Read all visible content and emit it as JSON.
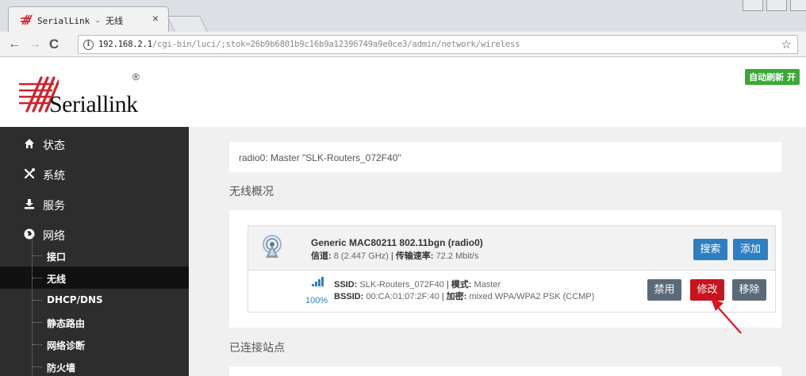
{
  "browser": {
    "tab_title": "SerialLink - 无线",
    "tab_close": "×",
    "url_host": "192.168.2.1",
    "url_path": "/cgi-bin/luci/;stok=26b9b6801b9c16b9a12396749a9e0ce3/admin/network/wireless",
    "info_glyph": "i",
    "back_glyph": "←",
    "forward_glyph": "→",
    "reload_glyph": "C",
    "star_glyph": "☆",
    "icons": [
      "serialink-favicon",
      "back-arrow-icon",
      "forward-arrow-icon",
      "reload-icon",
      "info-icon",
      "star-icon"
    ]
  },
  "header": {
    "logo_text": "Seriallink",
    "logo_reg": "®",
    "autorefresh_label": "自动刷新 开",
    "logo_color": "#d0212a",
    "autorefresh_color": "#3aa935"
  },
  "sidebar": {
    "items": [
      {
        "label": "状态",
        "icon": "home-icon"
      },
      {
        "label": "系统",
        "icon": "tools-icon"
      },
      {
        "label": "服务",
        "icon": "download-tray-icon"
      },
      {
        "label": "网络",
        "icon": "globe-icon"
      }
    ],
    "sub_items": [
      {
        "label": "接口"
      },
      {
        "label": "无线",
        "active": true
      },
      {
        "label": "DHCP/DNS"
      },
      {
        "label": "静态路由"
      },
      {
        "label": "网络诊断"
      },
      {
        "label": "防火墙"
      }
    ]
  },
  "main": {
    "radio_line": "radio0: Master \"SLK-Routers_072F40\"",
    "section_wireless": "无线概况",
    "section_stations": "已连接站点",
    "device": {
      "name": "Generic MAC80211 802.11bgn (radio0)",
      "channel_label": "信道:",
      "channel_value": "8 (2.447 GHz)",
      "sep": "|",
      "rate_label": "传输速率:",
      "rate_value": "72.2 Mbit/s",
      "scan_button": "搜索",
      "add_button": "添加"
    },
    "network": {
      "signal_pct": "100%",
      "ssid_label": "SSID:",
      "ssid_value": "SLK-Routers_072F40",
      "mode_label": "模式:",
      "mode_value": "Master",
      "bssid_label": "BSSID:",
      "bssid_value": "00:CA:01:07:2F:40",
      "enc_label": "加密:",
      "enc_value": "mixed WPA/WPA2 PSK (CCMP)",
      "disable_button": "禁用",
      "edit_button": "修改",
      "remove_button": "移除"
    },
    "colors": {
      "primary": "#2d7fc1",
      "danger": "#c8141c",
      "muted": "#5a6a78",
      "annotation_arrow": "#e0141c"
    }
  }
}
